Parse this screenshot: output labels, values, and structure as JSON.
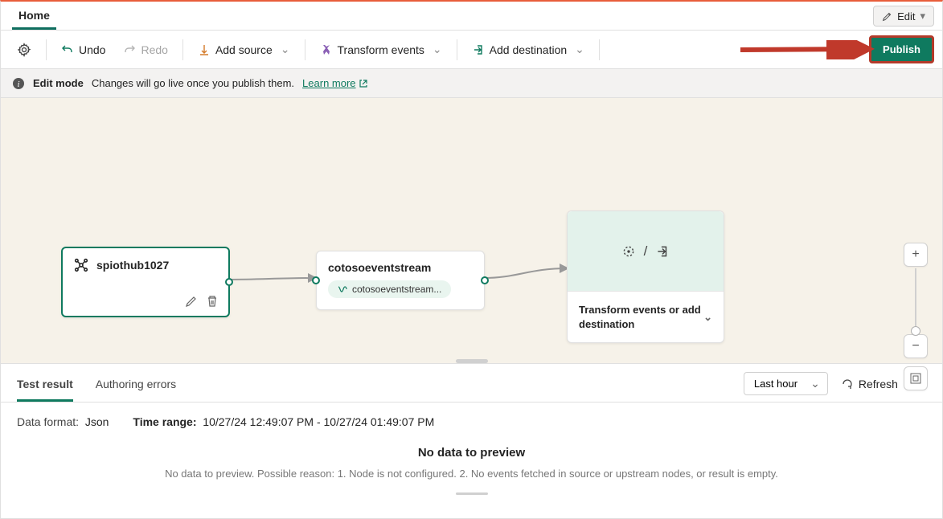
{
  "tabs": {
    "home": "Home",
    "edit": "Edit"
  },
  "toolbar": {
    "undo": "Undo",
    "redo": "Redo",
    "add_source": "Add source",
    "transform": "Transform events",
    "add_dest": "Add destination",
    "publish": "Publish"
  },
  "info": {
    "mode": "Edit mode",
    "msg": "Changes will go live once you publish them.",
    "learn": "Learn more"
  },
  "nodes": {
    "source": {
      "title": "spiothub1027"
    },
    "stream": {
      "title": "cotosoeventstream",
      "chip": "cotosoeventstream..."
    },
    "placeholder": {
      "label": "Transform events or add destination"
    }
  },
  "bottom": {
    "tabs": {
      "test": "Test result",
      "errors": "Authoring errors"
    },
    "time_options": [
      "Last hour"
    ],
    "time_selected": "Last hour",
    "refresh": "Refresh",
    "data_format_label": "Data format:",
    "data_format_value": "Json",
    "time_range_label": "Time range:",
    "time_range_value": "10/27/24 12:49:07 PM - 10/27/24 01:49:07 PM",
    "empty_title": "No data to preview",
    "empty_msg": "No data to preview. Possible reason: 1. Node is not configured. 2. No events fetched in source or upstream nodes, or result is empty."
  }
}
